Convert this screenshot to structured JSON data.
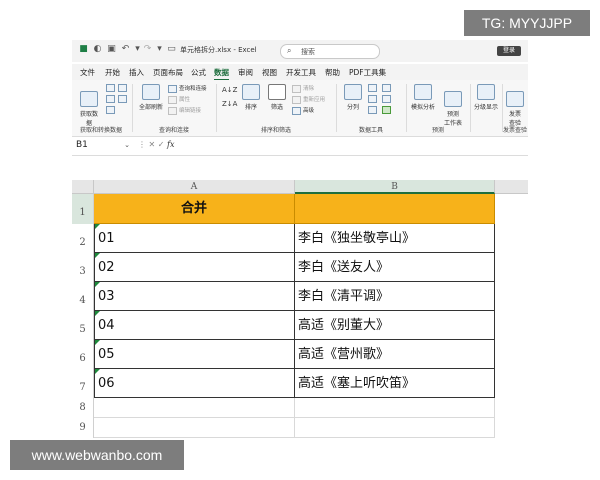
{
  "titlebar": {
    "file_title": "单元格拆分.xlsx - Excel",
    "search_placeholder": "搜索",
    "login_label": "登录"
  },
  "tabs": [
    "文件",
    "开始",
    "插入",
    "页面布局",
    "公式",
    "数据",
    "审阅",
    "视图",
    "开发工具",
    "帮助",
    "PDF工具集"
  ],
  "active_tab": "数据",
  "ribbon": {
    "get_data": {
      "button": "获取数\n据",
      "group": "获取和转换数据"
    },
    "query": {
      "refresh_all": "全部刷新",
      "queries_connections": "查询和连接",
      "properties": "属性",
      "edit_links": "编辑链接",
      "group": "查询和连接"
    },
    "sort_filter": {
      "sort": "排序",
      "filter": "筛选",
      "clear": "清除",
      "reapply": "重新应用",
      "advanced": "高级",
      "group": "排序和筛选"
    },
    "data_tools": {
      "split": "分列",
      "group": "数据工具"
    },
    "forecast": {
      "what_if": "模拟分析",
      "forecast_sheet": "预测\n工作表",
      "group": "预测"
    },
    "outline": {
      "label": "分级显示"
    },
    "share": {
      "button": "发票\n查验",
      "group": "发票查验"
    }
  },
  "formula_bar": {
    "name_box": "B1",
    "fx": "fx",
    "content": ""
  },
  "sheet": {
    "columns": [
      "A",
      "B"
    ],
    "rows": [
      "1",
      "2",
      "3",
      "4",
      "5",
      "6",
      "7",
      "8",
      "9"
    ],
    "header_row": [
      "合并",
      ""
    ],
    "data": [
      [
        "01",
        "李白《独坐敬亭山》"
      ],
      [
        "02",
        "李白《送友人》"
      ],
      [
        "03",
        "李白《清平调》"
      ],
      [
        "04",
        "高适《别董大》"
      ],
      [
        "05",
        "高适《营州歌》"
      ],
      [
        "06",
        "高适《塞上听吹笛》"
      ]
    ]
  },
  "watermarks": {
    "tg": "TG: MYYJJPP",
    "site": "www.webwanbo.com"
  },
  "colors": {
    "header_fill": "#f7b21a",
    "excel_green": "#1e6e3e"
  }
}
